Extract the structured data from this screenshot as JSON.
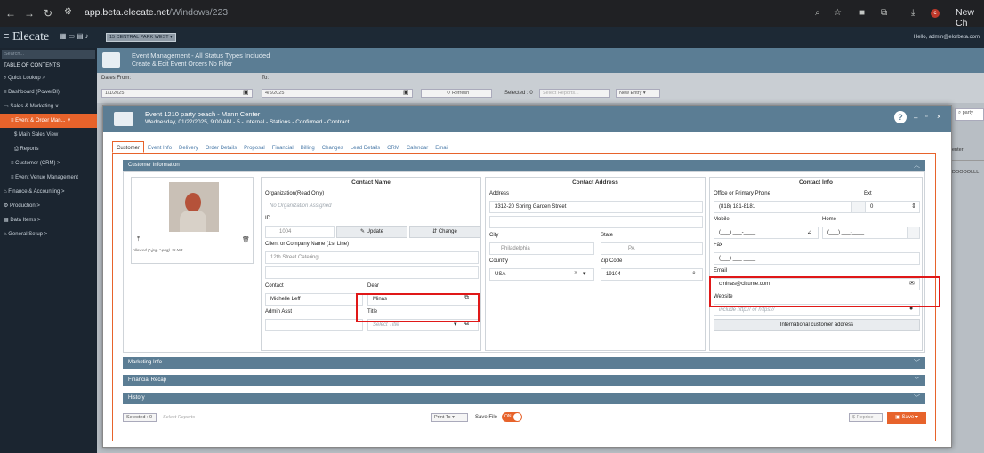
{
  "browser": {
    "url_host": "app.beta.elecate.net",
    "url_path": "/Windows/223",
    "new_chrome": "New Ch"
  },
  "app": {
    "logo": "Elecate",
    "property": "15 CENTRAL PARK WEST",
    "greeting": "Hello, admin@elorbeta.com"
  },
  "sidebar": {
    "search_placeholder": "Search...",
    "toc": "TABLE OF CONTENTS",
    "items": [
      {
        "label": "Quick Lookup  >",
        "icon": "search-icon"
      },
      {
        "label": "Dashboard (PowerBI)",
        "icon": "menu-icon"
      },
      {
        "label": "Sales & Marketing  ∨",
        "icon": "chart-icon"
      },
      {
        "label": "Event & Order Man...  ∨",
        "icon": "list-icon"
      },
      {
        "label": "Main Sales View",
        "icon": "dollar-icon"
      },
      {
        "label": "Reports",
        "icon": "printer-icon"
      },
      {
        "label": "Customer (CRM)  >",
        "icon": "menu-icon"
      },
      {
        "label": "Event Venue Management",
        "icon": "menu-icon"
      },
      {
        "label": "Finance & Accounting  >",
        "icon": "bank-icon"
      },
      {
        "label": "Production  >",
        "icon": "gear-icon"
      },
      {
        "label": "Data Items  >",
        "icon": "grid-icon"
      },
      {
        "label": "General Setup  >",
        "icon": "building-icon"
      }
    ]
  },
  "page": {
    "title": "Event Management - All Status Types Included",
    "subtitle": "Create & Edit Event Orders No Filter",
    "dates_from_label": "Dates From:",
    "dates_from": "1/1/2025",
    "to_label": "To:",
    "to": "4/5/2025",
    "refresh": "Refresh",
    "selected": "Selected : 0",
    "select_reports": "Select Reports...",
    "new_entry": "New Entry",
    "right_search": "party",
    "right_text1": "enter",
    "right_text2": "DOOOOLLL"
  },
  "modal": {
    "title": "Event 1210 party beach - Mann Center",
    "subtitle": "Wednesday, 01/22/2025, 9:00 AM - 5 - Internal - Stations - Confirmed - Contract",
    "tabs": [
      "Customer",
      "Event Info",
      "Delivery",
      "Order Details",
      "Proposal",
      "Financial",
      "Billing",
      "Changes",
      "Lead Details",
      "CRM",
      "Calendar",
      "Email"
    ],
    "section_customer": "Customer Information",
    "photo_hint": "Allowed (*.jpg, *.png) <5 MB",
    "contact_name": {
      "title": "Contact Name",
      "org_label": "Organization(Read Only)",
      "org_placeholder": "No Organization Assigned",
      "id_label": "ID",
      "id_value": "1004",
      "update": "Update",
      "change": "Change",
      "client_label": "Client or Company Name (1st Line)",
      "client_value": "12th Street Catering",
      "contact_label": "Contact",
      "contact_value": "Michelle Leff",
      "dear_label": "Dear",
      "dear_value": "Minas",
      "admin_label": "Admin Asst",
      "title_label": "Title",
      "title_placeholder": "Select Title"
    },
    "contact_address": {
      "title": "Contact Address",
      "address_label": "Address",
      "address_value": "3312-20 Spring Garden Street",
      "city_label": "City",
      "city_value": "Philadelphia",
      "state_label": "State",
      "state_value": "PA",
      "country_label": "Country",
      "country_value": "USA",
      "zip_label": "Zip Code",
      "zip_value": "19104"
    },
    "contact_info": {
      "title": "Contact Info",
      "phone_label": "Office or Primary Phone",
      "phone_value": "(818) 181-8181",
      "ext_label": "Ext",
      "ext_value": "0",
      "mobile_label": "Mobile",
      "mobile_value": "(___) ___-____",
      "home_label": "Home",
      "home_value": "(___) ___-____",
      "fax_label": "Fax",
      "fax_value": "(___) ___-____",
      "email_label": "Email",
      "email_value": "cminas@cikume.com",
      "website_label": "Website",
      "website_placeholder": "include http:// or https://",
      "intl_button": "International customer address"
    },
    "sections": [
      "Marketing Info",
      "Financial Recap",
      "History"
    ],
    "footer": {
      "selected": "Selected : 0",
      "select_reports": "Select Reports",
      "print_to": "Print To",
      "save_file": "Save File",
      "toggle": "ON",
      "reprice": "Reprice",
      "save": "Save"
    }
  },
  "colors": {
    "accent": "#e7632b",
    "header": "#5b7d94",
    "highlight": "#e01818"
  }
}
